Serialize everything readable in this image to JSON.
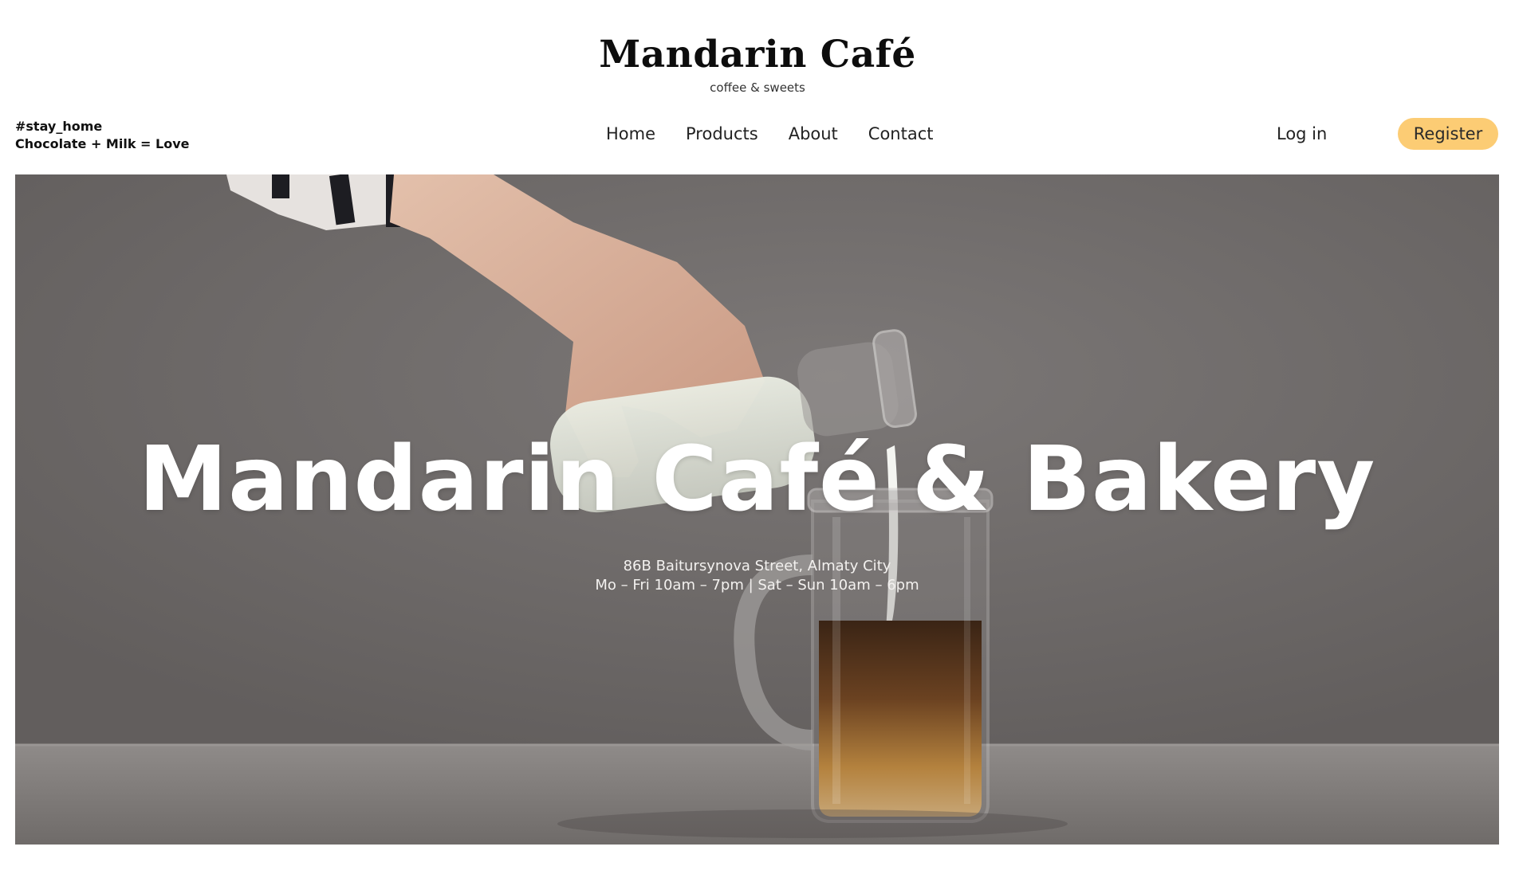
{
  "brand": {
    "title": "Mandarin Café",
    "subtitle": "coffee & sweets"
  },
  "tagline": {
    "line1": "#stay_home",
    "line2": "Chocolate + Milk = Love"
  },
  "nav": {
    "items": [
      {
        "label": "Home"
      },
      {
        "label": "Products"
      },
      {
        "label": "About"
      },
      {
        "label": "Contact"
      }
    ]
  },
  "auth": {
    "login_label": "Log in",
    "register_label": "Register"
  },
  "hero": {
    "title": "Mandarin Café & Bakery",
    "address": "86B Baitursynova Street, Almaty City",
    "hours": "Mo – Fri 10am – 7pm | Sat – Sun 10am – 6pm"
  },
  "colors": {
    "accent": "#fccc74",
    "hero_background": "#6e6a69"
  }
}
